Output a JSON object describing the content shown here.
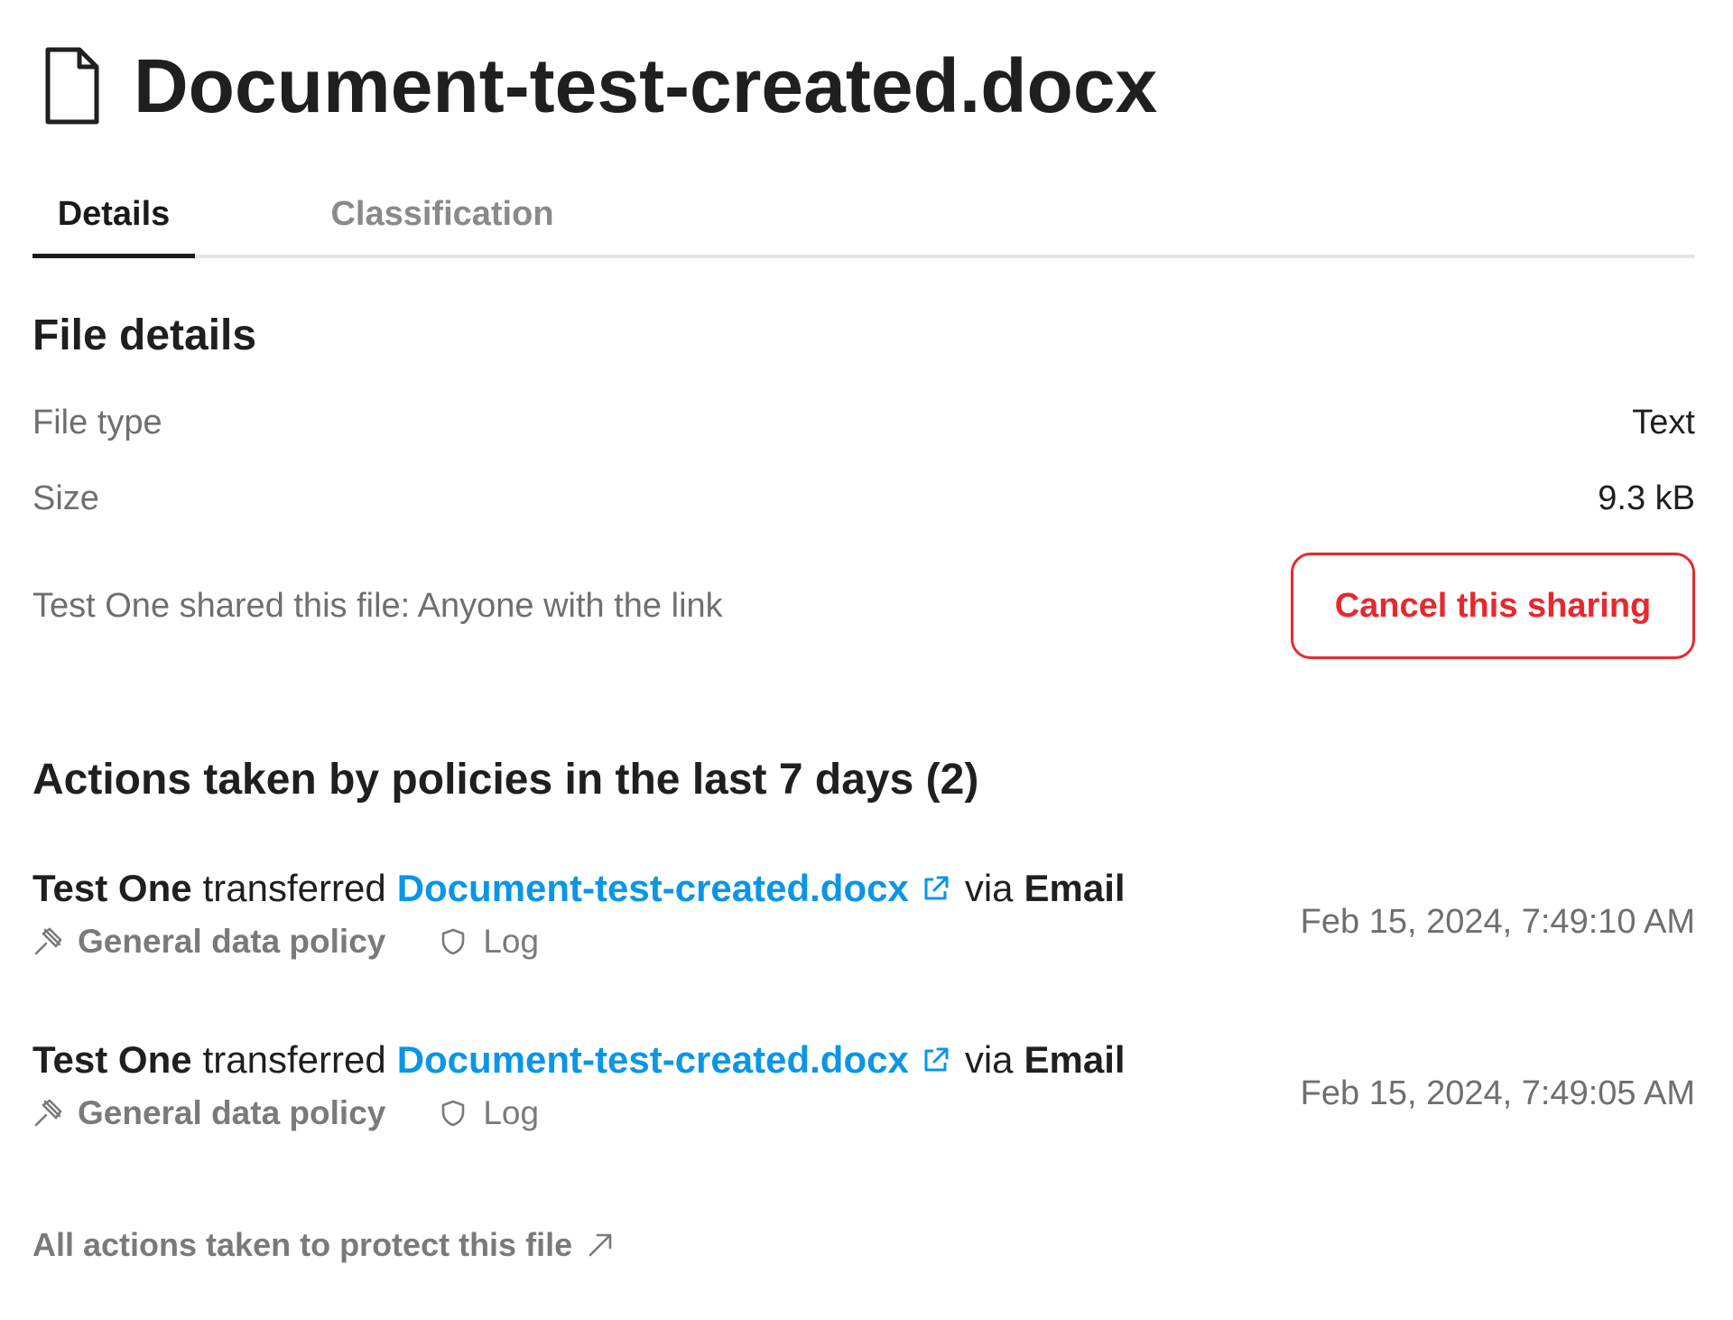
{
  "header": {
    "title": "Document-test-created.docx",
    "icon": "file-icon"
  },
  "tabs": [
    {
      "label": "Details",
      "active": true
    },
    {
      "label": "Classification",
      "active": false
    }
  ],
  "file_details": {
    "title": "File details",
    "rows": [
      {
        "label": "File type",
        "value": "Text"
      },
      {
        "label": "Size",
        "value": "9.3 kB"
      }
    ],
    "sharing_text": "Test One shared this file: Anyone with the link",
    "cancel_label": "Cancel this sharing"
  },
  "actions": {
    "title": "Actions taken by policies in the last 7 days (2)",
    "items": [
      {
        "actor": "Test One",
        "verb": "transferred",
        "file": "Document-test-created.docx",
        "via": "via",
        "channel": "Email",
        "policy": "General data policy",
        "mode": "Log",
        "timestamp": "Feb 15, 2024, 7:49:10 AM"
      },
      {
        "actor": "Test One",
        "verb": "transferred",
        "file": "Document-test-created.docx",
        "via": "via",
        "channel": "Email",
        "policy": "General data policy",
        "mode": "Log",
        "timestamp": "Feb 15, 2024, 7:49:05 AM"
      }
    ]
  },
  "footer": {
    "all_actions_label": "All actions taken to protect this file"
  },
  "colors": {
    "link": "#0a96e6",
    "danger": "#e6292e",
    "tab_underline": "#1a1a1a",
    "muted": "#7a7a7a"
  }
}
